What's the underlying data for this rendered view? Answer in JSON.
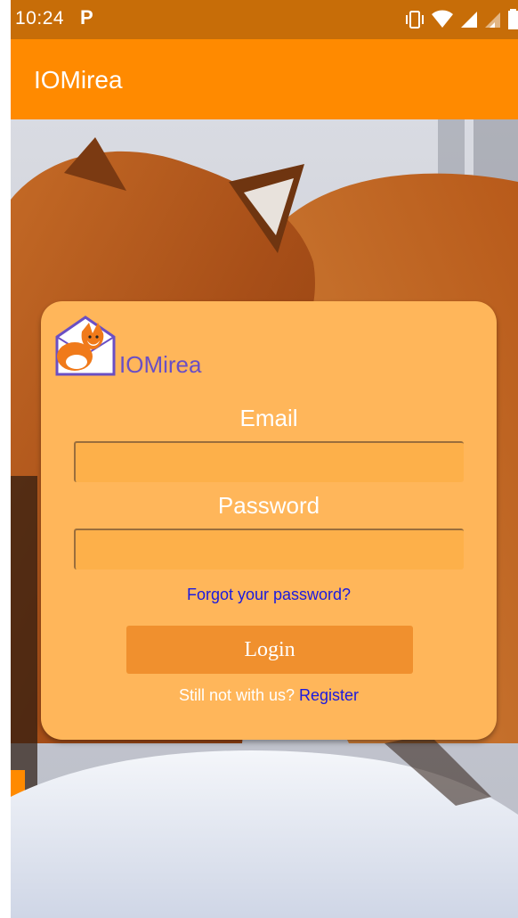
{
  "status_bar": {
    "time": "10:24",
    "notification_icon": "parking-p-icon",
    "icons": [
      "vibrate-icon",
      "wifi-icon",
      "signal-icon",
      "signal-weak-icon",
      "battery-icon"
    ]
  },
  "app_bar": {
    "title": "IOMirea"
  },
  "login_card": {
    "logo_text": "IOMirea",
    "logo_icon": "fox-envelope-logo",
    "email_label": "Email",
    "email_value": "",
    "password_label": "Password",
    "password_value": "",
    "forgot_label": "Forgot your password?",
    "login_label": "Login",
    "register_prompt": "Still not with us?",
    "register_label": "Register"
  },
  "colors": {
    "status_bar": "#c76d08",
    "app_bar": "#ff8a00",
    "card": "#ffb65a",
    "login_button": "#f0902e",
    "link": "#1a1adf",
    "logo_text": "#6a4fc4"
  }
}
